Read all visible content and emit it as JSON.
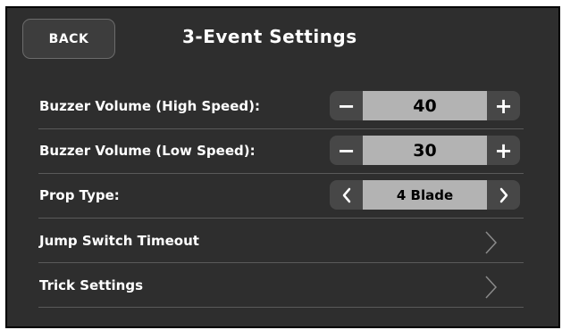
{
  "header": {
    "back_label": "BACK",
    "title": "3-Event Settings"
  },
  "rows": [
    {
      "label": "Buzzer Volume (High Speed):",
      "value": "40",
      "dec_symbol": "−",
      "inc_symbol": "+"
    },
    {
      "label": "Buzzer Volume (Low Speed):",
      "value": "30",
      "dec_symbol": "−",
      "inc_symbol": "+"
    },
    {
      "label": "Prop Type:",
      "value": "4 Blade",
      "prev_symbol": "‹",
      "next_symbol": "›"
    },
    {
      "label": "Jump Switch Timeout",
      "icon": "chevron-right-icon"
    },
    {
      "label": "Trick Settings",
      "icon": "chevron-right-icon"
    }
  ],
  "colors": {
    "background": "#2e2e2e",
    "stepper_button": "#474747",
    "stepper_value": "#b3b3b3",
    "divider": "#5a5a5a"
  }
}
